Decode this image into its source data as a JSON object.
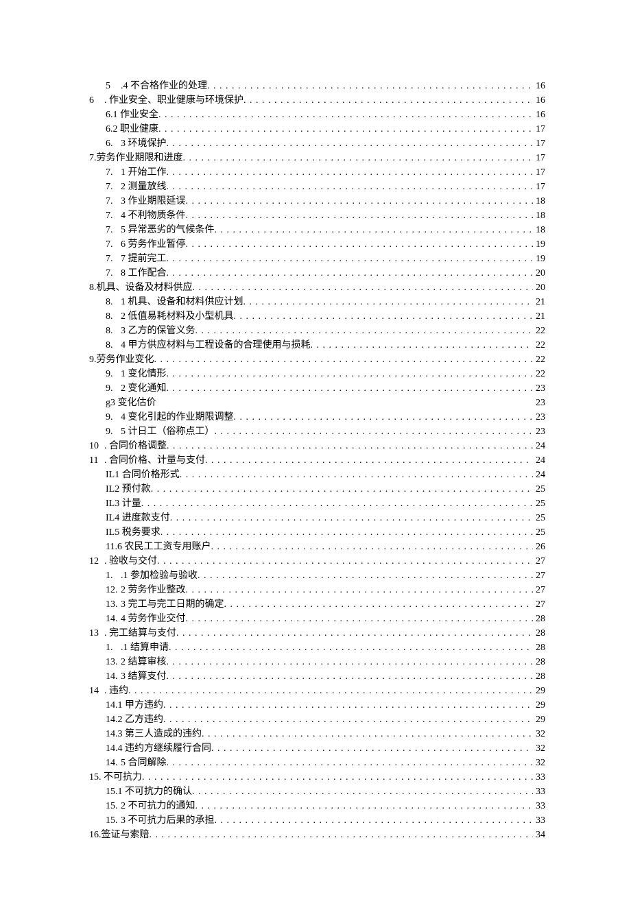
{
  "toc": [
    {
      "indent": 1,
      "num": "5",
      "title": ".4 不合格作业的处理",
      "page": "16",
      "leader": true
    },
    {
      "indent": 0,
      "num": "6",
      "title": ". 作业安全、职业健康与环境保护",
      "page": "16",
      "leader": true
    },
    {
      "indent": 1,
      "num": "",
      "title": "6.1 作业安全",
      "page": "16",
      "leader": true
    },
    {
      "indent": 1,
      "num": "",
      "title": "6.2 职业健康",
      "page": "17",
      "leader": true
    },
    {
      "indent": 1,
      "num": "6.",
      "title": "3 环境保护",
      "page": "17",
      "leader": true
    },
    {
      "indent": 0,
      "num": "",
      "title": "7.劳务作业期限和进度",
      "page": "17",
      "leader": true
    },
    {
      "indent": 1,
      "num": "7.",
      "title": "1 开始工作",
      "page": "17",
      "leader": true
    },
    {
      "indent": 1,
      "num": "7.",
      "title": "2 测量放线",
      "page": "17",
      "leader": true
    },
    {
      "indent": 1,
      "num": "7.",
      "title": "3 作业期限延误",
      "page": "18",
      "leader": true
    },
    {
      "indent": 1,
      "num": "7.",
      "title": "4 不利物质条件",
      "page": "18",
      "leader": true
    },
    {
      "indent": 1,
      "num": "7.",
      "title": "5 异常恶劣的气候条件",
      "page": "18",
      "leader": true
    },
    {
      "indent": 1,
      "num": "7.",
      "title": "6 劳务作业暂停",
      "page": "19",
      "leader": true
    },
    {
      "indent": 1,
      "num": "7.",
      "title": "7 提前完工",
      "page": "19",
      "leader": true
    },
    {
      "indent": 1,
      "num": "7.",
      "title": "8 工作配合",
      "page": "20",
      "leader": true
    },
    {
      "indent": 0,
      "num": "",
      "title": "8.机具、设备及材料供应",
      "page": "20",
      "leader": true
    },
    {
      "indent": 1,
      "num": "8.",
      "title": "1 机具、设备和材料供应计划",
      "page": "21",
      "leader": true
    },
    {
      "indent": 1,
      "num": "8.",
      "title": "2 低值易耗材料及小型机具",
      "page": "21",
      "leader": true
    },
    {
      "indent": 1,
      "num": "8.",
      "title": "3 乙方的保管义务",
      "page": "22",
      "leader": true
    },
    {
      "indent": 1,
      "num": "8.",
      "title": "4 甲方供应材料与工程设备的合理使用与损耗",
      "page": "22",
      "leader": true
    },
    {
      "indent": 0,
      "num": "",
      "title": "9.劳务作业变化",
      "page": "22",
      "leader": true
    },
    {
      "indent": 1,
      "num": "9.",
      "title": "1 变化情形",
      "page": "22",
      "leader": true
    },
    {
      "indent": 1,
      "num": "9.",
      "title": "2 变化通知",
      "page": "23",
      "leader": true
    },
    {
      "indent": 1,
      "num": "",
      "title": "g3 变化估价",
      "page": "23",
      "leader": false
    },
    {
      "indent": 1,
      "num": "9.",
      "title": "4 变化引起的作业期限调整",
      "page": "23",
      "leader": true
    },
    {
      "indent": 1,
      "num": "9.",
      "title": "5 计日工（俗称点工）",
      "page": "23",
      "leader": true
    },
    {
      "indent": 0,
      "num": "10",
      "title": ". 合同价格调整",
      "page": "24",
      "leader": true
    },
    {
      "indent": 0,
      "num": "11",
      "title": ". 合同价格、计量与支付",
      "page": "24",
      "leader": true
    },
    {
      "indent": 1,
      "num": "",
      "title": "IL1 合同价格形式",
      "page": "24",
      "leader": true
    },
    {
      "indent": 1,
      "num": "",
      "title": "IL2 预付款",
      "page": "25",
      "leader": true
    },
    {
      "indent": 1,
      "num": "",
      "title": "IL3 计量",
      "page": "25",
      "leader": true
    },
    {
      "indent": 1,
      "num": "",
      "title": "IL4 进度款支付",
      "page": "25",
      "leader": true
    },
    {
      "indent": 1,
      "num": "",
      "title": "IL5 税务要求",
      "page": "25",
      "leader": true
    },
    {
      "indent": 1,
      "num": "",
      "title": "11.6 农民工工资专用账户",
      "page": "26",
      "leader": true
    },
    {
      "indent": 0,
      "num": "12",
      "title": ". 验收与交付",
      "page": "27",
      "leader": true
    },
    {
      "indent": 1,
      "num": "1.",
      "title": ".1 参加检验与验收",
      "page": "27",
      "leader": true
    },
    {
      "indent": 1,
      "num": "12.",
      "title": "2 劳务作业整改",
      "page": "27",
      "leader": true
    },
    {
      "indent": 1,
      "num": "13.",
      "title": "3 完工与完工日期的确定",
      "page": "27",
      "leader": true
    },
    {
      "indent": 1,
      "num": "14.",
      "title": "4 劳务作业交付",
      "page": "28",
      "leader": true
    },
    {
      "indent": 0,
      "num": "13",
      "title": ". 完工结算与支付",
      "page": "28",
      "leader": true
    },
    {
      "indent": 1,
      "num": "1.",
      "title": ".1 结算申请",
      "page": "28",
      "leader": true
    },
    {
      "indent": 1,
      "num": "13.",
      "title": "2 结算审核",
      "page": "28",
      "leader": true
    },
    {
      "indent": 1,
      "num": "14.",
      "title": "3 结算支付",
      "page": "28",
      "leader": true
    },
    {
      "indent": 0,
      "num": "14",
      "title": ". 违约",
      "page": "29",
      "leader": true
    },
    {
      "indent": 1,
      "num": "",
      "title": "14.1 甲方违约",
      "page": "29",
      "leader": true
    },
    {
      "indent": 1,
      "num": "",
      "title": "14.2 乙方违约",
      "page": "29",
      "leader": true
    },
    {
      "indent": 1,
      "num": "",
      "title": "14.3 第三人造成的违约",
      "page": "32",
      "leader": true
    },
    {
      "indent": 1,
      "num": "",
      "title": "14.4 违约方继续履行合同",
      "page": "32",
      "leader": true
    },
    {
      "indent": 1,
      "num": "14.",
      "title": "5 合同解除",
      "page": "32",
      "leader": true
    },
    {
      "indent": 0,
      "num": "",
      "title": "15. 不可抗力",
      "page": "33",
      "leader": true
    },
    {
      "indent": 1,
      "num": "",
      "title": "15.1   不可抗力的确认",
      "page": "33",
      "leader": true
    },
    {
      "indent": 1,
      "num": "15.",
      "title": "2 不可抗力的通知",
      "page": "33",
      "leader": true
    },
    {
      "indent": 1,
      "num": "15.",
      "title": "3 不可抗力后果的承担",
      "page": "33",
      "leader": true
    },
    {
      "indent": 0,
      "num": "",
      "title": "16.签证与索赔",
      "page": "34",
      "leader": true
    }
  ]
}
